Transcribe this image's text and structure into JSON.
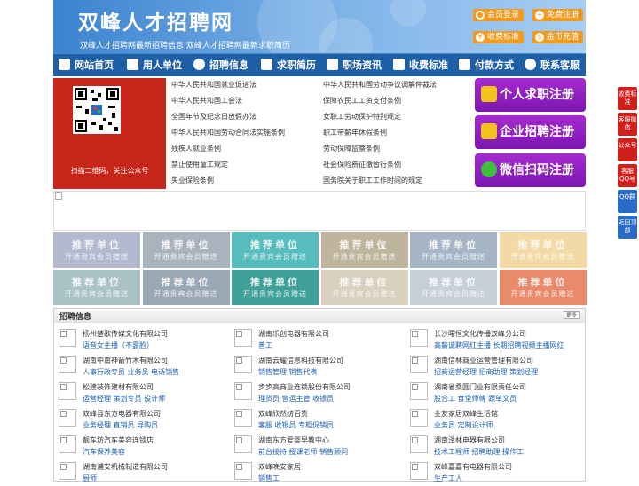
{
  "header": {
    "site_title": "双峰人才招聘网",
    "subtitle": "双峰人才招聘网最新招聘信息   双峰人才招聘网最新求职简历",
    "buttons": [
      {
        "label": "会员登录",
        "icon": "user-icon"
      },
      {
        "label": "免费注册",
        "icon": "register-icon"
      },
      {
        "label": "收费标准",
        "icon": "price-icon"
      },
      {
        "label": "金币充值",
        "icon": "coin-icon"
      }
    ]
  },
  "nav": {
    "items": [
      {
        "label": "网站首页",
        "icon": "home-icon"
      },
      {
        "label": "用人单位",
        "icon": "building-icon"
      },
      {
        "label": "招聘信息",
        "icon": "recruit-icon"
      },
      {
        "label": "求职简历",
        "icon": "resume-icon"
      },
      {
        "label": "职场资讯",
        "icon": "news-icon"
      },
      {
        "label": "收费标准",
        "icon": "price-icon"
      },
      {
        "label": "付款方式",
        "icon": "payment-icon"
      },
      {
        "label": "联系客服",
        "icon": "service-icon"
      }
    ]
  },
  "qr": {
    "caption": "扫描二维码，关注公众号"
  },
  "laws": {
    "left": [
      "中华人民共和国就业促进法",
      "中华人民共和国工会法",
      "全国年节及纪念日放假办法",
      "中华人民共和国劳动合同法实施条例",
      "残疾人就业条例",
      "禁止使用童工规定",
      "失业保险条例"
    ],
    "right": [
      "中华人民共和国劳动争议调解仲裁法",
      "保障农民工工资支付条例",
      "女职工劳动保护特别规定",
      "职工带薪年休假条例",
      "劳动保障监察条例",
      "社会保险费征缴暂行条例",
      "国务院关于职工工作时间的规定"
    ]
  },
  "register": [
    {
      "label": "个人求职注册",
      "icon": "person-icon"
    },
    {
      "label": "企业招聘注册",
      "icon": "company-icon"
    },
    {
      "label": "微信扫码注册",
      "icon": "wechat-icon"
    }
  ],
  "promo": {
    "title": "推荐单位",
    "subtitle": "开通贵宾会员赠送",
    "colors": [
      "#b3b9cf",
      "#a9b3bd",
      "#57bcbd",
      "#bfb49c",
      "#a5b5c5",
      "#f2d9a5",
      "#a9c3c7",
      "#9aa7b5",
      "#3fa19a",
      "#d9d0c0",
      "#c7cfd9",
      "#e98a6a"
    ]
  },
  "jobs": {
    "title": "招聘信息",
    "more_label": "更多",
    "items": [
      {
        "company": "扬州楚歌传媒文化有限公司",
        "positions": "语音女主播（不露脸）"
      },
      {
        "company": "湖南乐创电器有限公司",
        "positions": "普工"
      },
      {
        "company": "长沙曙恒文化传播双峰分公司",
        "positions": "高薪诚聘网红主播 长期招聘视频主播网红"
      },
      {
        "company": "湖南中南神箭竹木有限公司",
        "positions": "人事行政专员 业务员 电话销售"
      },
      {
        "company": "湖南云耀信息科技有限公司",
        "positions": "销售管理 销售代表"
      },
      {
        "company": "湖南信林商业运营管理有限公司",
        "positions": "招商运营经理 招商助理 策划经理"
      },
      {
        "company": "松建装饰建材有限公司",
        "positions": "运营经理 策划专员 设计师"
      },
      {
        "company": "步步高商业连锁股份有限公司",
        "positions": "理货员 营运主管 收银员"
      },
      {
        "company": "湖南省桑圆门业有限责任公司",
        "positions": "股合工 食堂师傅 跟单文员"
      },
      {
        "company": "双峰县东方电器有限公司",
        "positions": "业务经理 直销员 导购员"
      },
      {
        "company": "双峰欣然纺百货",
        "positions": "客服 收银员 专柜促销员"
      },
      {
        "company": "金友家居双峰生活馆",
        "positions": "业务员 定制设计师"
      },
      {
        "company": "靓车坊汽车美容连锁店",
        "positions": "汽车保养美容"
      },
      {
        "company": "湖南东方爱婴早教中心",
        "positions": "前台接待 授课老师 销售顾问"
      },
      {
        "company": "湖南泽林电器有限公司",
        "positions": "技术工程师 招聘助理 操作工"
      },
      {
        "company": "湖南浦安机械制造有限公司",
        "positions": "厨师"
      },
      {
        "company": "双峰晚安家居",
        "positions": "销售工"
      },
      {
        "company": "双峰嘉嘉有电器有限公司",
        "positions": "生产工人"
      }
    ]
  },
  "right_sidebar": [
    {
      "label": "收费标准"
    },
    {
      "label": "客服微信"
    },
    {
      "label": "公众号"
    },
    {
      "label": "客服QQ号"
    },
    {
      "label": "QQ群"
    },
    {
      "label": "返回顶部"
    }
  ]
}
